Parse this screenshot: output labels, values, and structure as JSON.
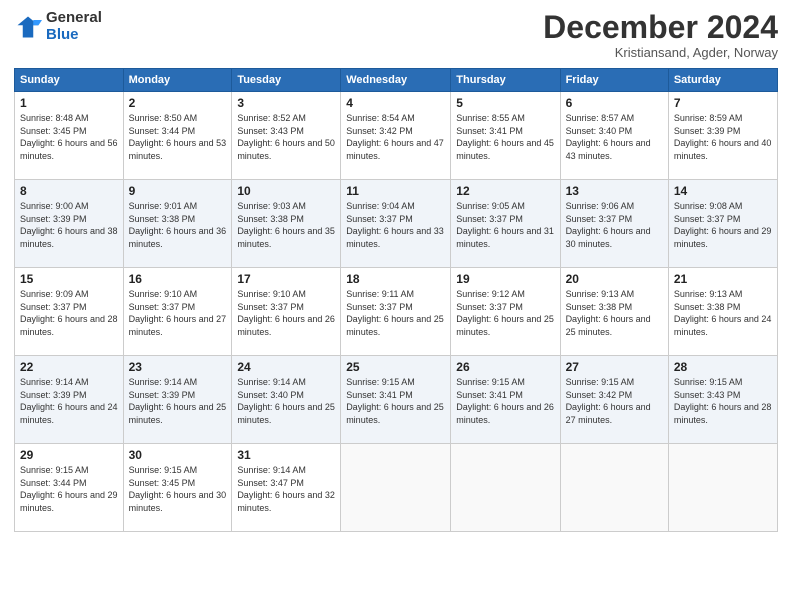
{
  "logo": {
    "general": "General",
    "blue": "Blue"
  },
  "title": "December 2024",
  "location": "Kristiansand, Agder, Norway",
  "headers": [
    "Sunday",
    "Monday",
    "Tuesday",
    "Wednesday",
    "Thursday",
    "Friday",
    "Saturday"
  ],
  "weeks": [
    [
      {
        "day": "1",
        "sunrise": "8:48 AM",
        "sunset": "3:45 PM",
        "daylight": "6 hours and 56 minutes."
      },
      {
        "day": "2",
        "sunrise": "8:50 AM",
        "sunset": "3:44 PM",
        "daylight": "6 hours and 53 minutes."
      },
      {
        "day": "3",
        "sunrise": "8:52 AM",
        "sunset": "3:43 PM",
        "daylight": "6 hours and 50 minutes."
      },
      {
        "day": "4",
        "sunrise": "8:54 AM",
        "sunset": "3:42 PM",
        "daylight": "6 hours and 47 minutes."
      },
      {
        "day": "5",
        "sunrise": "8:55 AM",
        "sunset": "3:41 PM",
        "daylight": "6 hours and 45 minutes."
      },
      {
        "day": "6",
        "sunrise": "8:57 AM",
        "sunset": "3:40 PM",
        "daylight": "6 hours and 43 minutes."
      },
      {
        "day": "7",
        "sunrise": "8:59 AM",
        "sunset": "3:39 PM",
        "daylight": "6 hours and 40 minutes."
      }
    ],
    [
      {
        "day": "8",
        "sunrise": "9:00 AM",
        "sunset": "3:39 PM",
        "daylight": "6 hours and 38 minutes."
      },
      {
        "day": "9",
        "sunrise": "9:01 AM",
        "sunset": "3:38 PM",
        "daylight": "6 hours and 36 minutes."
      },
      {
        "day": "10",
        "sunrise": "9:03 AM",
        "sunset": "3:38 PM",
        "daylight": "6 hours and 35 minutes."
      },
      {
        "day": "11",
        "sunrise": "9:04 AM",
        "sunset": "3:37 PM",
        "daylight": "6 hours and 33 minutes."
      },
      {
        "day": "12",
        "sunrise": "9:05 AM",
        "sunset": "3:37 PM",
        "daylight": "6 hours and 31 minutes."
      },
      {
        "day": "13",
        "sunrise": "9:06 AM",
        "sunset": "3:37 PM",
        "daylight": "6 hours and 30 minutes."
      },
      {
        "day": "14",
        "sunrise": "9:08 AM",
        "sunset": "3:37 PM",
        "daylight": "6 hours and 29 minutes."
      }
    ],
    [
      {
        "day": "15",
        "sunrise": "9:09 AM",
        "sunset": "3:37 PM",
        "daylight": "6 hours and 28 minutes."
      },
      {
        "day": "16",
        "sunrise": "9:10 AM",
        "sunset": "3:37 PM",
        "daylight": "6 hours and 27 minutes."
      },
      {
        "day": "17",
        "sunrise": "9:10 AM",
        "sunset": "3:37 PM",
        "daylight": "6 hours and 26 minutes."
      },
      {
        "day": "18",
        "sunrise": "9:11 AM",
        "sunset": "3:37 PM",
        "daylight": "6 hours and 25 minutes."
      },
      {
        "day": "19",
        "sunrise": "9:12 AM",
        "sunset": "3:37 PM",
        "daylight": "6 hours and 25 minutes."
      },
      {
        "day": "20",
        "sunrise": "9:13 AM",
        "sunset": "3:38 PM",
        "daylight": "6 hours and 25 minutes."
      },
      {
        "day": "21",
        "sunrise": "9:13 AM",
        "sunset": "3:38 PM",
        "daylight": "6 hours and 24 minutes."
      }
    ],
    [
      {
        "day": "22",
        "sunrise": "9:14 AM",
        "sunset": "3:39 PM",
        "daylight": "6 hours and 24 minutes."
      },
      {
        "day": "23",
        "sunrise": "9:14 AM",
        "sunset": "3:39 PM",
        "daylight": "6 hours and 25 minutes."
      },
      {
        "day": "24",
        "sunrise": "9:14 AM",
        "sunset": "3:40 PM",
        "daylight": "6 hours and 25 minutes."
      },
      {
        "day": "25",
        "sunrise": "9:15 AM",
        "sunset": "3:41 PM",
        "daylight": "6 hours and 25 minutes."
      },
      {
        "day": "26",
        "sunrise": "9:15 AM",
        "sunset": "3:41 PM",
        "daylight": "6 hours and 26 minutes."
      },
      {
        "day": "27",
        "sunrise": "9:15 AM",
        "sunset": "3:42 PM",
        "daylight": "6 hours and 27 minutes."
      },
      {
        "day": "28",
        "sunrise": "9:15 AM",
        "sunset": "3:43 PM",
        "daylight": "6 hours and 28 minutes."
      }
    ],
    [
      {
        "day": "29",
        "sunrise": "9:15 AM",
        "sunset": "3:44 PM",
        "daylight": "6 hours and 29 minutes."
      },
      {
        "day": "30",
        "sunrise": "9:15 AM",
        "sunset": "3:45 PM",
        "daylight": "6 hours and 30 minutes."
      },
      {
        "day": "31",
        "sunrise": "9:14 AM",
        "sunset": "3:47 PM",
        "daylight": "6 hours and 32 minutes."
      },
      null,
      null,
      null,
      null
    ]
  ]
}
